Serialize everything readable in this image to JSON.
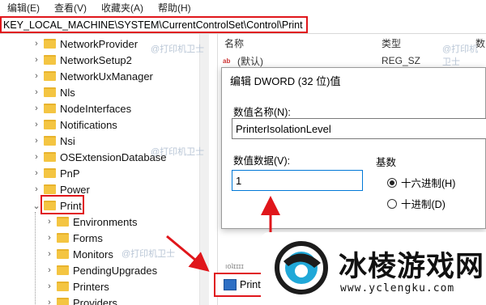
{
  "menu": [
    "编辑(E)",
    "查看(V)",
    "收藏夹(A)",
    "帮助(H)"
  ],
  "address": "KEY_LOCAL_MACHINE\\SYSTEM\\CurrentControlSet\\Control\\Print",
  "tree": {
    "items": [
      {
        "label": "NetworkProvider",
        "level": 1
      },
      {
        "label": "NetworkSetup2",
        "level": 1
      },
      {
        "label": "NetworkUxManager",
        "level": 1
      },
      {
        "label": "Nls",
        "level": 1
      },
      {
        "label": "NodeInterfaces",
        "level": 1
      },
      {
        "label": "Notifications",
        "level": 1
      },
      {
        "label": "Nsi",
        "level": 1
      },
      {
        "label": "OSExtensionDatabase",
        "level": 1
      },
      {
        "label": "PnP",
        "level": 1
      },
      {
        "label": "Power",
        "level": 1
      },
      {
        "label": "Print",
        "level": 1,
        "expanded": true
      },
      {
        "label": "Environments",
        "level": 2
      },
      {
        "label": "Forms",
        "level": 2
      },
      {
        "label": "Monitors",
        "level": 2
      },
      {
        "label": "PendingUpgrades",
        "level": 2
      },
      {
        "label": "Printers",
        "level": 2
      },
      {
        "label": "Providers",
        "level": 2
      }
    ]
  },
  "list": {
    "headers": {
      "name": "名称",
      "type": "类型",
      "data": "数"
    },
    "rows": [
      {
        "name": "(默认)",
        "type": "REG_SZ"
      }
    ],
    "selected_value": "Printe"
  },
  "dialog": {
    "title": "编辑 DWORD (32 位)值",
    "name_label": "数值名称(N):",
    "name_value": "PrinterIsolationLevel",
    "data_label": "数值数据(V):",
    "data_value": "1",
    "base_label": "基数",
    "radio_hex": "十六进制(H)",
    "radio_dec": "十进制(D)",
    "base_selected": "hex"
  },
  "watermark": "@打印机卫士",
  "logo": {
    "text": "冰棱游戏网",
    "url": "www.yclengku.com"
  },
  "colors": {
    "highlight": "#e0161b",
    "folder": "#f4c542",
    "accent": "#0078d7"
  }
}
